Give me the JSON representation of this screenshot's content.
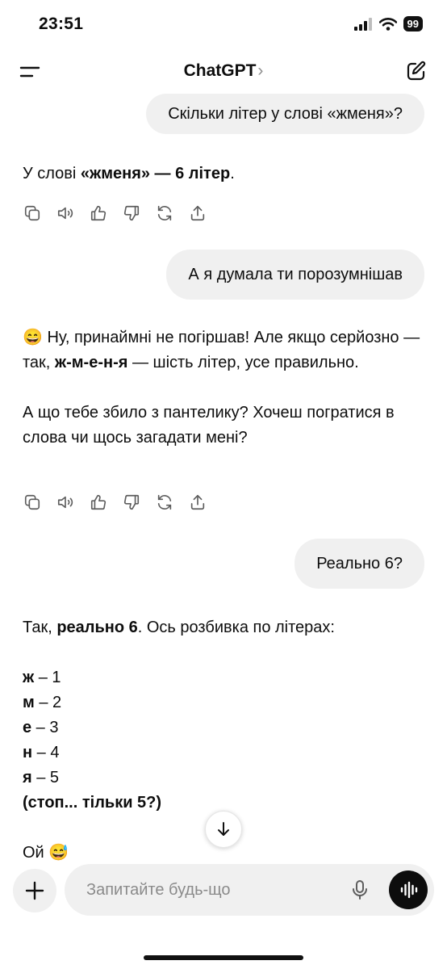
{
  "status_bar": {
    "time": "23:51",
    "battery": "99"
  },
  "header": {
    "title": "ChatGPT",
    "chevron": "›"
  },
  "messages": {
    "user1": "Скільки літер у слові «жменя»?",
    "assistant1": {
      "p1": "У слові ",
      "b1": "«жменя» — 6 літер",
      "p2": "."
    },
    "user2": "А я думала ти порозумнішав",
    "assistant2": {
      "emoji": "😄",
      "p1": " Ну, принаймні не погіршав! Але якщо серйозно — так, ",
      "b1": "ж-м-е-н-я",
      "p2": " — шість літер, усе правильно.",
      "para2": "А що тебе збило з пантелику? Хочеш погратися в слова чи щось загадати мені?"
    },
    "user3": "Реально 6?",
    "assistant3": {
      "p1": "Так, ",
      "b1": "реально 6",
      "p2": ". Ось розбивка по літерах:",
      "letters": [
        {
          "l": "ж",
          "n": " – 1"
        },
        {
          "l": "м",
          "n": " – 2"
        },
        {
          "l": "е",
          "n": " – 3"
        },
        {
          "l": "н",
          "n": " – 4"
        },
        {
          "l": "я",
          "n": " – 5"
        }
      ],
      "stop": "(стоп... тільки 5?)",
      "oi": "Ой ",
      "oi_emoji": "😅"
    }
  },
  "composer": {
    "placeholder": "Запитайте будь-що"
  },
  "icons": {
    "copy": "copy-icon",
    "speaker": "read-aloud-icon",
    "like": "thumbs-up-icon",
    "dislike": "thumbs-down-icon",
    "regenerate": "regenerate-icon",
    "share": "share-icon"
  }
}
